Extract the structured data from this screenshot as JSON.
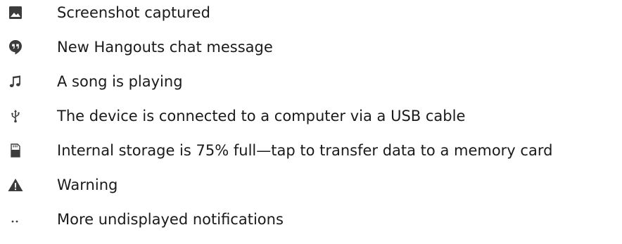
{
  "notifications": [
    {
      "icon": "image-icon",
      "text": "Screenshot captured"
    },
    {
      "icon": "hangouts-icon",
      "text": "New Hangouts chat message"
    },
    {
      "icon": "music-note-icon",
      "text": "A song is playing"
    },
    {
      "icon": "usb-icon",
      "text": "The device is connected to a computer via a USB cable"
    },
    {
      "icon": "storage-icon",
      "text": "Internal storage is 75% full—tap to transfer data to a memory card"
    },
    {
      "icon": "warning-icon",
      "text": "Warning"
    },
    {
      "icon": "more-dots-icon",
      "text": "More undisplayed notifications"
    }
  ],
  "colors": {
    "icon": "#3c3c3c",
    "text": "#1a1a1a",
    "background": "#ffffff"
  }
}
